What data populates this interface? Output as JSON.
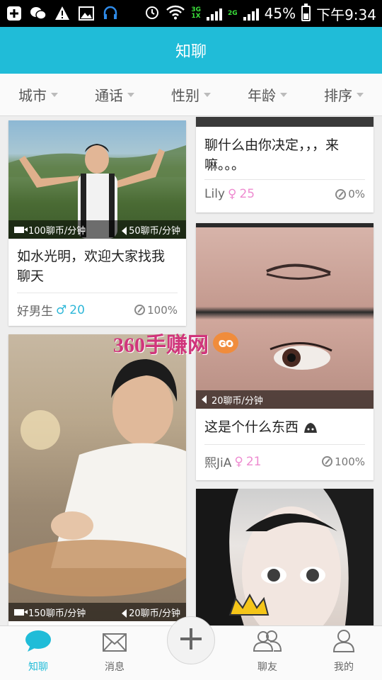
{
  "status_bar": {
    "net_top": "3G",
    "net_bottom": "1X",
    "net2": "2G",
    "battery": "45%",
    "time": "下午9:34",
    "icons": [
      "add-icon",
      "wechat-icon",
      "warning-icon",
      "image-icon",
      "headset-icon",
      "alarm-icon",
      "wifi-icon",
      "signal-icon",
      "battery-icon"
    ]
  },
  "header": {
    "title": "知聊"
  },
  "filters": [
    {
      "label": "城市"
    },
    {
      "label": "通话"
    },
    {
      "label": "性别"
    },
    {
      "label": "年龄"
    },
    {
      "label": "排序"
    }
  ],
  "cards": [
    {
      "video_price": "100聊币/分钟",
      "voice_price": "50聊币/分钟",
      "title": "如水光明，欢迎大家找我聊天",
      "name": "好男生",
      "sex": "♂",
      "age": "20",
      "rate": "100%"
    },
    {
      "title": "聊什么由你决定，，，来嘛。。。",
      "name": "Lily",
      "sex": "♀",
      "age": "25",
      "rate": "0%"
    },
    {
      "voice_price": "20聊币/分钟",
      "title": "这是个什么东西",
      "name": "熙JiA",
      "sex": "♀",
      "age": "21",
      "rate": "100%"
    },
    {
      "video_price": "150聊币/分钟",
      "voice_price": "20聊币/分钟"
    }
  ],
  "watermark": {
    "text": "360手赚网",
    "badge": "GO"
  },
  "bottom_nav": [
    {
      "label": "知聊",
      "icon": "chat-bubble-icon",
      "active": true
    },
    {
      "label": "消息",
      "icon": "envelope-icon",
      "active": false
    },
    {
      "label": "聊友",
      "icon": "friends-icon",
      "active": false
    },
    {
      "label": "我的",
      "icon": "person-icon",
      "active": false
    }
  ],
  "colors": {
    "accent": "#20bcd8",
    "male": "#2fb7d8",
    "female": "#ee8bd0"
  }
}
